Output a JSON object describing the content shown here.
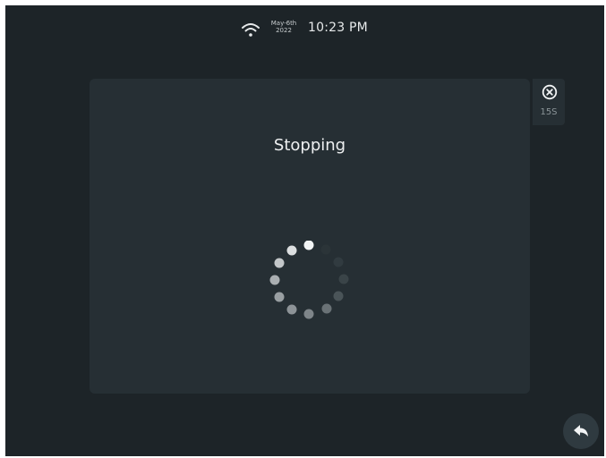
{
  "status_bar": {
    "wifi_icon": "wifi-icon",
    "date_line1": "May-6th",
    "date_line2": "2022",
    "time": "10:23 PM"
  },
  "dialog": {
    "title": "Stopping",
    "spinner_icon": "loading-spinner-icon",
    "close_icon": "close-circle-icon",
    "countdown": "15S"
  },
  "back_button": {
    "icon": "reply-arrow-icon"
  },
  "colors": {
    "background": "#1d2428",
    "panel": "#262f34",
    "text": "#eef0f1",
    "muted": "#8b9498"
  }
}
